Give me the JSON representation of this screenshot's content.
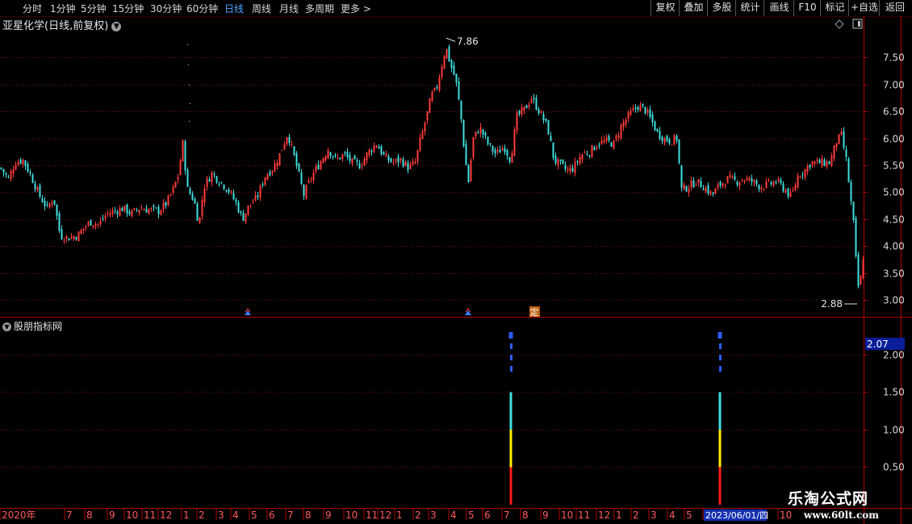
{
  "toolbar": {
    "periods": [
      "分时",
      "1分钟",
      "5分钟",
      "15分钟",
      "30分钟",
      "60分钟",
      "日线",
      "周线",
      "月线",
      "多周期",
      "更多 >"
    ],
    "active_period": "日线",
    "actions": [
      "复权",
      "叠加",
      "多股",
      "统计",
      "画线",
      "F10",
      "标记",
      "+自选",
      "返回"
    ]
  },
  "stock_title": "亚星化学(日线,前复权)",
  "indicator_panel_title": "股朋指标网",
  "colors": {
    "up": "#ff3b3b",
    "down": "#3fe0e0",
    "grid": "#7a1010",
    "axis_text": "#d8d8d8",
    "blue_marker": "#2f5bff",
    "bar_cyan": "#3fe0e0",
    "bar_yellow": "#ffee00",
    "bar_red": "#ff1a1a"
  },
  "chart_data": [
    {
      "type": "candlestick",
      "title": "亚星化学(日线,前复权)",
      "ylim": [
        2.7,
        8.0
      ],
      "yticks": [
        3.0,
        3.5,
        4.0,
        4.5,
        5.0,
        5.5,
        6.0,
        6.5,
        7.0,
        7.5
      ],
      "ytick_labels": [
        "3.00",
        "3.50",
        "4.00",
        "4.50",
        "5.00",
        "5.50",
        "6.00",
        "6.50",
        "7.00",
        "7.50"
      ],
      "annotations": [
        {
          "text": "7.86",
          "value": 7.86,
          "label": "highest"
        },
        {
          "text": "2.88",
          "value": 2.88,
          "label": "lowest"
        }
      ],
      "markers": [
        {
          "text": "定",
          "label": "event-marker"
        }
      ],
      "close_path": [
        [
          0,
          5.45
        ],
        [
          10,
          5.25
        ],
        [
          18,
          5.55
        ],
        [
          28,
          5.6
        ],
        [
          38,
          5.3
        ],
        [
          48,
          4.95
        ],
        [
          58,
          4.7
        ],
        [
          66,
          4.9
        ],
        [
          74,
          4.2
        ],
        [
          84,
          4.15
        ],
        [
          96,
          4.2
        ],
        [
          104,
          4.35
        ],
        [
          112,
          4.45
        ],
        [
          122,
          4.4
        ],
        [
          132,
          4.6
        ],
        [
          142,
          4.65
        ],
        [
          152,
          4.7
        ],
        [
          162,
          4.6
        ],
        [
          172,
          4.7
        ],
        [
          182,
          4.68
        ],
        [
          196,
          4.65
        ],
        [
          206,
          4.8
        ],
        [
          214,
          5.05
        ],
        [
          220,
          5.3
        ],
        [
          226,
          5.9
        ],
        [
          232,
          5.05
        ],
        [
          240,
          4.85
        ],
        [
          246,
          4.4
        ],
        [
          252,
          5.1
        ],
        [
          262,
          5.35
        ],
        [
          272,
          5.2
        ],
        [
          282,
          5.05
        ],
        [
          292,
          4.8
        ],
        [
          300,
          4.5
        ],
        [
          308,
          4.75
        ],
        [
          318,
          4.9
        ],
        [
          328,
          5.3
        ],
        [
          338,
          5.45
        ],
        [
          346,
          5.7
        ],
        [
          356,
          6.1
        ],
        [
          366,
          5.55
        ],
        [
          376,
          4.95
        ],
        [
          386,
          5.3
        ],
        [
          396,
          5.55
        ],
        [
          406,
          5.8
        ],
        [
          416,
          5.6
        ],
        [
          426,
          5.7
        ],
        [
          436,
          5.55
        ],
        [
          446,
          5.5
        ],
        [
          456,
          5.75
        ],
        [
          466,
          5.9
        ],
        [
          476,
          5.65
        ],
        [
          486,
          5.55
        ],
        [
          496,
          5.6
        ],
        [
          506,
          5.45
        ],
        [
          514,
          5.55
        ],
        [
          520,
          5.95
        ],
        [
          528,
          6.4
        ],
        [
          534,
          6.8
        ],
        [
          540,
          6.9
        ],
        [
          546,
          7.3
        ],
        [
          552,
          7.7
        ],
        [
          558,
          7.35
        ],
        [
          564,
          7.1
        ],
        [
          570,
          6.5
        ],
        [
          576,
          5.6
        ],
        [
          580,
          5.2
        ],
        [
          586,
          6.0
        ],
        [
          594,
          6.2
        ],
        [
          604,
          5.9
        ],
        [
          614,
          5.7
        ],
        [
          624,
          5.85
        ],
        [
          632,
          5.6
        ],
        [
          640,
          6.4
        ],
        [
          650,
          6.55
        ],
        [
          658,
          6.75
        ],
        [
          668,
          6.5
        ],
        [
          678,
          6.2
        ],
        [
          686,
          5.6
        ],
        [
          694,
          5.5
        ],
        [
          702,
          5.4
        ],
        [
          710,
          5.45
        ],
        [
          720,
          5.7
        ],
        [
          730,
          5.75
        ],
        [
          740,
          5.9
        ],
        [
          750,
          5.95
        ],
        [
          760,
          5.9
        ],
        [
          770,
          6.25
        ],
        [
          780,
          6.45
        ],
        [
          790,
          6.6
        ],
        [
          798,
          6.55
        ],
        [
          806,
          6.35
        ],
        [
          814,
          6.1
        ],
        [
          822,
          6.0
        ],
        [
          830,
          5.95
        ],
        [
          838,
          6.0
        ],
        [
          844,
          5.05
        ],
        [
          852,
          5.1
        ],
        [
          862,
          5.2
        ],
        [
          872,
          5.1
        ],
        [
          882,
          4.95
        ],
        [
          892,
          5.15
        ],
        [
          902,
          5.25
        ],
        [
          912,
          5.2
        ],
        [
          922,
          5.25
        ],
        [
          932,
          5.2
        ],
        [
          942,
          5.1
        ],
        [
          952,
          5.15
        ],
        [
          962,
          5.2
        ],
        [
          972,
          5.05
        ],
        [
          980,
          4.9
        ],
        [
          988,
          5.3
        ],
        [
          996,
          5.4
        ],
        [
          1004,
          5.55
        ],
        [
          1012,
          5.55
        ],
        [
          1020,
          5.55
        ],
        [
          1028,
          5.55
        ],
        [
          1036,
          5.95
        ],
        [
          1042,
          6.05
        ],
        [
          1048,
          5.6
        ],
        [
          1054,
          4.8
        ],
        [
          1058,
          4.3
        ],
        [
          1062,
          3.2
        ],
        [
          1066,
          3.4
        ],
        [
          1072,
          4.2
        ]
      ]
    },
    {
      "type": "bar",
      "title": "股朋指标网",
      "ylim": [
        0,
        2.3
      ],
      "yticks": [
        0.5,
        1.0,
        1.5,
        2.0
      ],
      "ytick_labels": [
        "0.50",
        "1.00",
        "1.50",
        "2.00"
      ],
      "current_value_label": "2.07",
      "signals": [
        {
          "segments": [
            {
              "from": 0,
              "to": 0.5,
              "color": "red"
            },
            {
              "from": 0.5,
              "to": 1.0,
              "color": "yellow"
            },
            {
              "from": 1.0,
              "to": 1.5,
              "color": "cyan"
            }
          ],
          "dashes_top": 2.3,
          "dashes_bottom": 1.8
        },
        {
          "segments": [
            {
              "from": 0,
              "to": 0.5,
              "color": "red"
            },
            {
              "from": 0.5,
              "to": 1.0,
              "color": "yellow"
            },
            {
              "from": 1.0,
              "to": 1.5,
              "color": "cyan"
            }
          ],
          "dashes_top": 2.3,
          "dashes_bottom": 1.8
        }
      ]
    }
  ],
  "x_axis": {
    "labels": [
      "2020年",
      "7",
      "8",
      "9",
      "10",
      "11",
      "12",
      "1",
      "2",
      "3",
      "4",
      "5",
      "6",
      "7",
      "8",
      "9",
      "10",
      "11",
      "12",
      "1",
      "2",
      "3",
      "4",
      "5",
      "6",
      "7",
      "8",
      "9",
      "10",
      "11",
      "12",
      "1",
      "2",
      "3",
      "4",
      "5",
      "6",
      "7",
      "8",
      "9",
      "10"
    ],
    "highlighted_date": "2023/06/01/四"
  },
  "logo": {
    "line1": "乐淘公式网",
    "line2": "www.60lt.com"
  }
}
